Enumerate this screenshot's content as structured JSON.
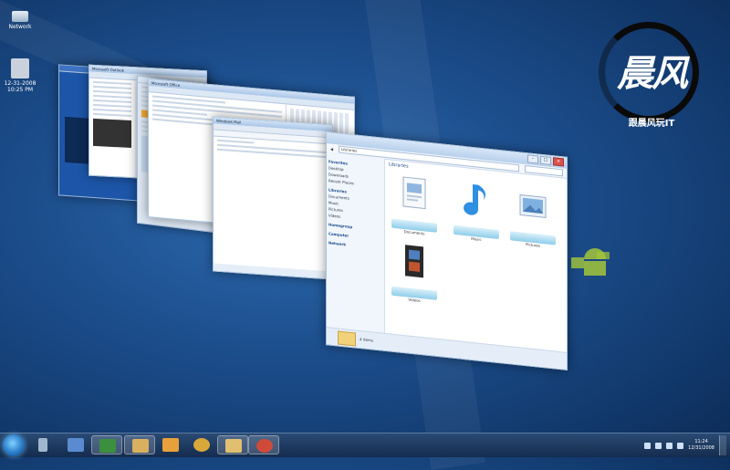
{
  "desktop": {
    "icons": [
      {
        "label": "Network",
        "icon": "computer-icon"
      },
      {
        "label": "12-31-2008 10:25 PM",
        "icon": "file-icon"
      }
    ],
    "logo": {
      "mark": "晨风",
      "caption": "跟晨风玩IT"
    }
  },
  "windows": {
    "mail": {
      "title": "Microsoft Outlook"
    },
    "email_editor": {
      "title": "Microsoft Office"
    },
    "file_manager": {
      "title": "Windows Mail"
    },
    "explorer": {
      "title": "Libraries",
      "address": "Libraries",
      "nav_sections": [
        "Favorites",
        "Libraries",
        "Homegroup",
        "Computer",
        "Network"
      ],
      "nav_items": [
        "Desktop",
        "Downloads",
        "Recent Places",
        "Documents",
        "Music",
        "Pictures",
        "Videos"
      ],
      "libraries": [
        {
          "name": "Documents",
          "icon": "documents-library-icon"
        },
        {
          "name": "Music",
          "icon": "music-library-icon"
        },
        {
          "name": "Pictures",
          "icon": "pictures-library-icon"
        },
        {
          "name": "Videos",
          "icon": "videos-library-icon"
        }
      ],
      "status_count": "4 items"
    }
  },
  "taskbar": {
    "clock_time": "11:24",
    "clock_date": "12/31/2008",
    "buttons": [
      {
        "name": "recycle-bin",
        "color": "#9fb6cc"
      },
      {
        "name": "folder-blue",
        "color": "#5a8bd0"
      },
      {
        "name": "media-center",
        "color": "#3c8f3c"
      },
      {
        "name": "explorer",
        "color": "#d8b060"
      },
      {
        "name": "media-player",
        "color": "#e8a13a"
      },
      {
        "name": "firefox",
        "color": "#d8a83a"
      },
      {
        "name": "mail",
        "color": "#e0c070"
      },
      {
        "name": "chrome",
        "color": "#d04a3a"
      }
    ]
  },
  "colors": {
    "accent": "#1b4a8a",
    "desktop": "#1d4f8e"
  }
}
